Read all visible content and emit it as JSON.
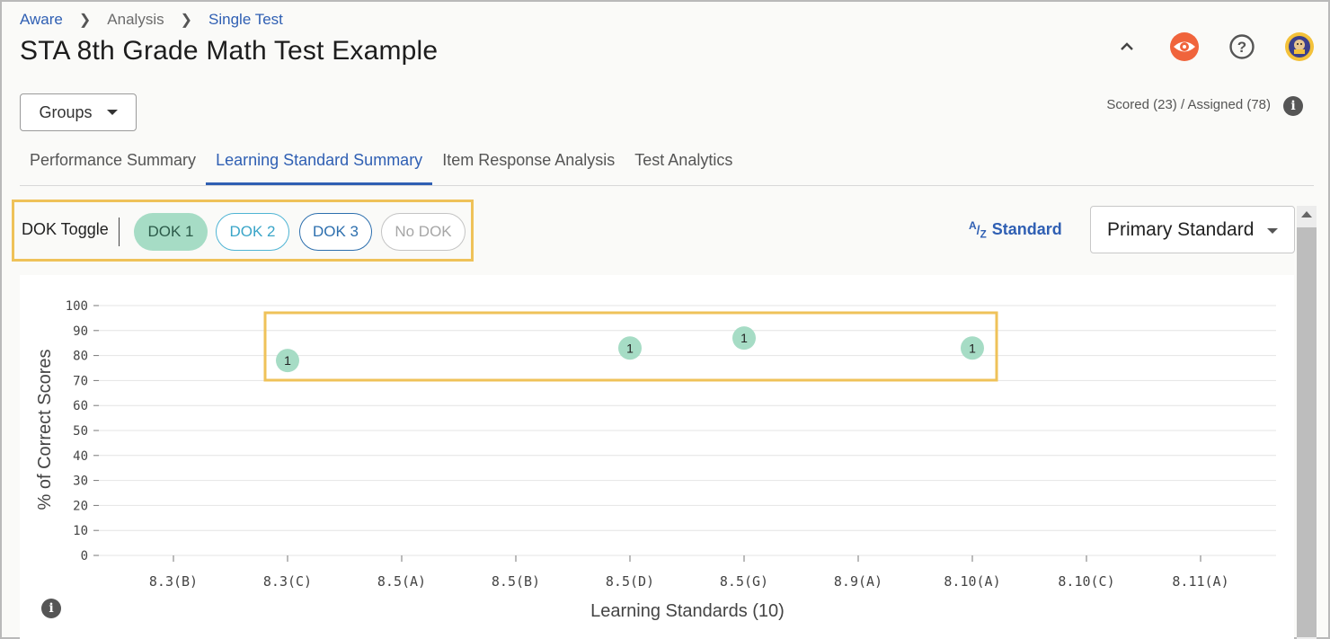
{
  "breadcrumb": {
    "item1": "Aware",
    "item2": "Analysis",
    "item3": "Single Test"
  },
  "title": "STA 8th Grade Math Test Example",
  "groups_label": "Groups",
  "scored_text": "Scored (23) / Assigned (78)",
  "tabs": [
    {
      "label": "Performance Summary"
    },
    {
      "label": "Learning Standard Summary"
    },
    {
      "label": "Item Response Analysis"
    },
    {
      "label": "Test Analytics"
    }
  ],
  "dok": {
    "label": "DOK Toggle",
    "dok1": "DOK 1",
    "dok2": "DOK 2",
    "dok3": "DOK 3",
    "nodok": "No DOK"
  },
  "sort": {
    "az_a": "A",
    "az_z": "Z",
    "label": "Standard"
  },
  "standard_select": {
    "value": "Primary Standard"
  },
  "colors": {
    "accent": "#2f5fb3",
    "highlight": "#efc259",
    "bubble": "#a6dcc5",
    "eye": "#f0643c"
  },
  "icons": [
    "chevron-up-icon",
    "eye-icon",
    "help-icon",
    "school-logo-icon",
    "info-icon"
  ],
  "chart_data": {
    "type": "scatter",
    "xlabel": "Learning Standards (10)",
    "ylabel": "% of Correct Scores",
    "ylim": [
      0,
      100
    ],
    "yticks": [
      0,
      10,
      20,
      30,
      40,
      50,
      60,
      70,
      80,
      90,
      100
    ],
    "categories": [
      "8.3(B)",
      "8.3(C)",
      "8.5(A)",
      "8.5(B)",
      "8.5(D)",
      "8.5(G)",
      "8.9(A)",
      "8.10(A)",
      "8.10(C)",
      "8.11(A)"
    ],
    "points": [
      {
        "x": "8.3(C)",
        "y": 78,
        "label": "1"
      },
      {
        "x": "8.5(D)",
        "y": 83,
        "label": "1"
      },
      {
        "x": "8.5(G)",
        "y": 87,
        "label": "1"
      },
      {
        "x": "8.10(A)",
        "y": 83,
        "label": "1"
      }
    ],
    "grid": true
  }
}
